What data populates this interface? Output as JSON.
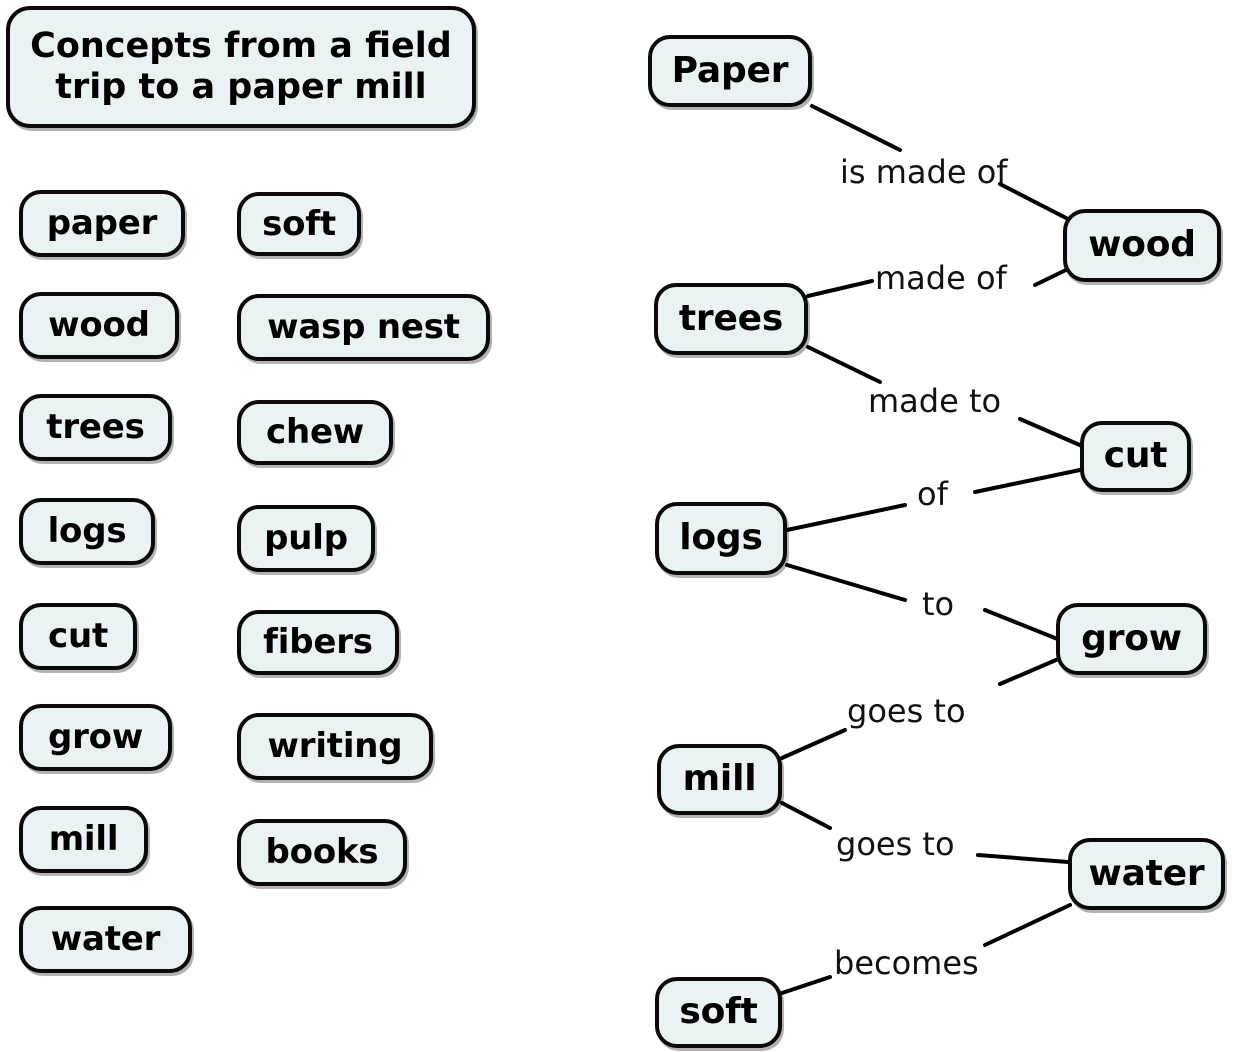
{
  "title": {
    "line1": "Concepts from a field",
    "line2": "trip to a paper mill",
    "full": "Concepts from a field trip to a paper mill"
  },
  "theme": {
    "node_fill": "#eaf2f3",
    "node_border": "#0a0a0a",
    "text_color": "#000000",
    "background": "#ffffff",
    "link_color": "#000000"
  },
  "concept_list": {
    "column_1": [
      {
        "label": "paper"
      },
      {
        "label": "wood"
      },
      {
        "label": "trees"
      },
      {
        "label": "logs"
      },
      {
        "label": "cut"
      },
      {
        "label": "grow"
      },
      {
        "label": "mill"
      },
      {
        "label": "water"
      }
    ],
    "column_2": [
      {
        "label": "soft"
      },
      {
        "label": "wasp nest"
      },
      {
        "label": "chew"
      },
      {
        "label": "pulp"
      },
      {
        "label": "fibers"
      },
      {
        "label": "writing"
      },
      {
        "label": "books"
      }
    ]
  },
  "concept_map": {
    "nodes": [
      {
        "id": "paper",
        "label": "Paper"
      },
      {
        "id": "wood",
        "label": "wood"
      },
      {
        "id": "trees",
        "label": "trees"
      },
      {
        "id": "cut",
        "label": "cut"
      },
      {
        "id": "logs",
        "label": "logs"
      },
      {
        "id": "grow",
        "label": "grow"
      },
      {
        "id": "mill",
        "label": "mill"
      },
      {
        "id": "water",
        "label": "water"
      },
      {
        "id": "soft",
        "label": "soft"
      }
    ],
    "links": [
      {
        "from": "paper",
        "to": "wood",
        "label": "is made of"
      },
      {
        "from": "trees",
        "to": "wood",
        "label": "made of"
      },
      {
        "from": "trees",
        "to": "cut",
        "label": "made to"
      },
      {
        "from": "logs",
        "to": "cut",
        "label": "of"
      },
      {
        "from": "logs",
        "to": "grow",
        "label": "to"
      },
      {
        "from": "mill",
        "to": "grow",
        "label": "goes to"
      },
      {
        "from": "mill",
        "to": "water",
        "label": "goes to"
      },
      {
        "from": "soft",
        "to": "water",
        "label": "becomes"
      }
    ]
  }
}
